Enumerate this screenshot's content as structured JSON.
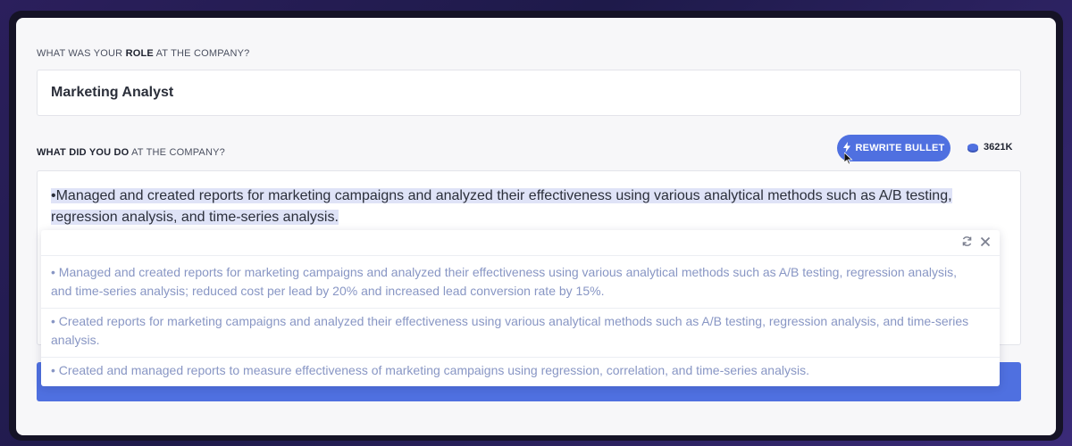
{
  "form": {
    "role_label_prefix": "WHAT WAS YOUR ",
    "role_label_bold": "ROLE",
    "role_label_suffix": " AT THE COMPANY?",
    "role_value": "Marketing Analyst",
    "do_label_bold": "WHAT DID YOU DO",
    "do_label_suffix": " AT THE COMPANY?",
    "bullet_text": "•Managed and created reports for marketing campaigns and analyzed their effectiveness using various analytical methods such as A/B testing, regression analysis, and time-series analysis."
  },
  "toolbar": {
    "rewrite_label": "REWRITE BULLET",
    "rewrite_icon": "bolt-icon",
    "credits": "3621K",
    "credits_icon": "coin-icon"
  },
  "suggestions": {
    "items": [
      "• Managed and created reports for marketing campaigns and analyzed their effectiveness using various analytical methods such as A/B testing, regression analysis, and time-series analysis; reduced cost per lead by 20% and increased lead conversion rate by 15%.",
      "• Created reports for marketing campaigns and analyzed their effectiveness using various analytical methods such as A/B testing, regression analysis, and time-series analysis.",
      "• Created and managed reports to measure effectiveness of marketing campaigns using regression, correlation, and time-series analysis."
    ],
    "icons": [
      "refresh-icon",
      "close-icon"
    ]
  },
  "colors": {
    "accent": "#4f70e0",
    "suggestion_text": "#8896c4",
    "highlight": "#dfe3f7"
  }
}
